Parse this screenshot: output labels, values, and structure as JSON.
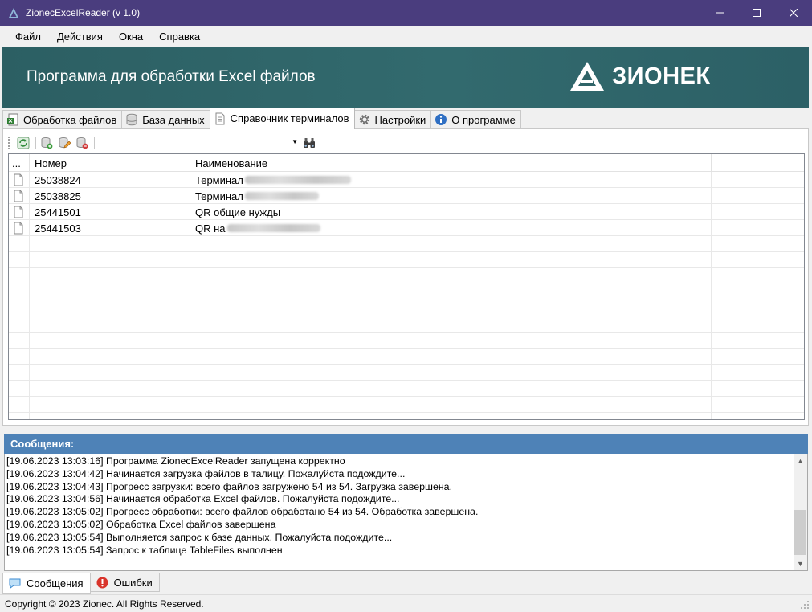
{
  "window": {
    "title": "ZionecExcelReader (v 1.0)"
  },
  "menu": [
    "Файл",
    "Действия",
    "Окна",
    "Справка"
  ],
  "banner": {
    "title": "Программа для обработки Excel файлов",
    "logo_text": "ЗИОНЕК"
  },
  "tabs": [
    {
      "label": "Обработка файлов",
      "icon": "excel-file-icon"
    },
    {
      "label": "База данных",
      "icon": "database-icon"
    },
    {
      "label": "Справочник терминалов",
      "icon": "document-icon",
      "active": true
    },
    {
      "label": "Настройки",
      "icon": "gear-icon"
    },
    {
      "label": "О программе",
      "icon": "info-icon"
    }
  ],
  "grid": {
    "columns": [
      "...",
      "Номер",
      "Наименование",
      ""
    ],
    "rows": [
      {
        "number": "25038824",
        "name": "Терминал",
        "redacted": true
      },
      {
        "number": "25038825",
        "name": "Терминал",
        "redacted": true
      },
      {
        "number": "25441501",
        "name": "QR общие нужды",
        "redacted": false
      },
      {
        "number": "25441503",
        "name": "QR на",
        "redacted": true
      }
    ]
  },
  "messages": {
    "header": "Сообщения:",
    "lines": [
      "[19.06.2023 13:03:16] Программа ZionecExcelReader запущена корректно",
      "[19.06.2023 13:04:42] Начинается загрузка файлов в талицу. Пожалуйста подождите...",
      "[19.06.2023 13:04:43] Прогресс загрузки: всего файлов загружено 54 из 54. Загрузка завершена.",
      "[19.06.2023 13:04:56] Начинается обработка Excel файлов. Пожалуйста подождите...",
      "[19.06.2023 13:05:02] Прогресс обработки: всего файлов обработано 54 из 54. Обработка завершена.",
      "[19.06.2023 13:05:02] Обработка Excel файлов завершена",
      "[19.06.2023 13:05:54] Выполняется запрос к базе данных. Пожалуйста подождите...",
      "[19.06.2023 13:05:54] Запрос к таблице TableFiles выполнен"
    ]
  },
  "bottom_tabs": [
    {
      "label": "Сообщения",
      "icon": "speech-bubble-icon",
      "active": true
    },
    {
      "label": "Ошибки",
      "icon": "error-icon"
    }
  ],
  "status": {
    "copyright": "Copyright © 2023 Zionec. All Rights Reserved."
  },
  "colors": {
    "titlebar": "#4a3d7e",
    "banner": "#2f6468",
    "messages_header": "#4e82b7"
  }
}
